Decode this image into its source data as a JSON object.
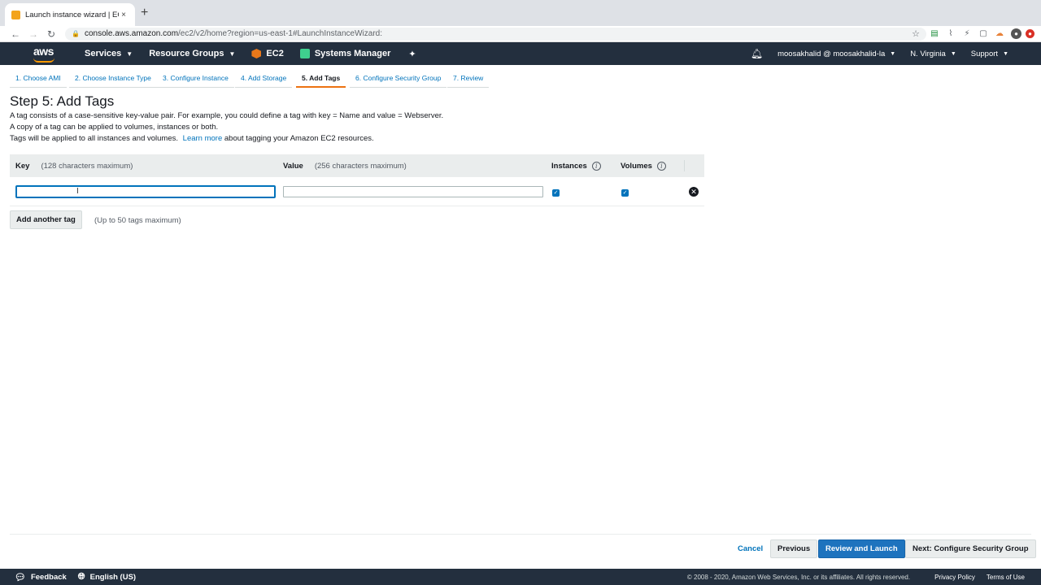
{
  "browser": {
    "tab_title": "Launch instance wizard | EC2 M",
    "tab_close": "×",
    "new_tab": "+",
    "url_host": "console.aws.amazon.com",
    "url_path": "/ec2/v2/home?region=us-east-1#LaunchInstanceWizard:"
  },
  "awsnav": {
    "logo": "aws",
    "services": "Services",
    "resource_groups": "Resource Groups",
    "ec2": "EC2",
    "systems_manager": "Systems Manager",
    "account": "moosakhalid @ moosakhalid-la",
    "region": "N. Virginia",
    "support": "Support"
  },
  "wizard": {
    "steps": [
      {
        "label": "1. Choose AMI"
      },
      {
        "label": "2. Choose Instance Type"
      },
      {
        "label": "3. Configure Instance"
      },
      {
        "label": "4. Add Storage"
      },
      {
        "label": "5. Add Tags"
      },
      {
        "label": "6. Configure Security Group"
      },
      {
        "label": "7. Review"
      }
    ],
    "title": "Step 5: Add Tags",
    "desc_line1": "A tag consists of a case-sensitive key-value pair. For example, you could define a tag with key = Name and value = Webserver.",
    "desc_line2": "A copy of a tag can be applied to volumes, instances or both.",
    "desc_line3": "Tags will be applied to all instances and volumes.",
    "learn_more": "Learn more",
    "desc_line3_tail": "about tagging your Amazon EC2 resources."
  },
  "tags_table": {
    "key_header": "Key",
    "key_hint": "(128 characters maximum)",
    "value_header": "Value",
    "value_hint": "(256 characters maximum)",
    "instances_header": "Instances",
    "volumes_header": "Volumes",
    "info_symbol": "i",
    "rows": [
      {
        "key": "",
        "value": "",
        "instances": true,
        "volumes": true
      }
    ]
  },
  "add_tag": {
    "button": "Add another tag",
    "hint": "(Up to 50 tags maximum)"
  },
  "actions": {
    "cancel": "Cancel",
    "previous": "Previous",
    "review_launch": "Review and Launch",
    "next": "Next: Configure Security Group"
  },
  "footer": {
    "feedback": "Feedback",
    "language": "English (US)",
    "copyright": "© 2008 - 2020, Amazon Web Services, Inc. or its affiliates. All rights reserved.",
    "privacy": "Privacy Policy",
    "terms": "Terms of Use"
  }
}
